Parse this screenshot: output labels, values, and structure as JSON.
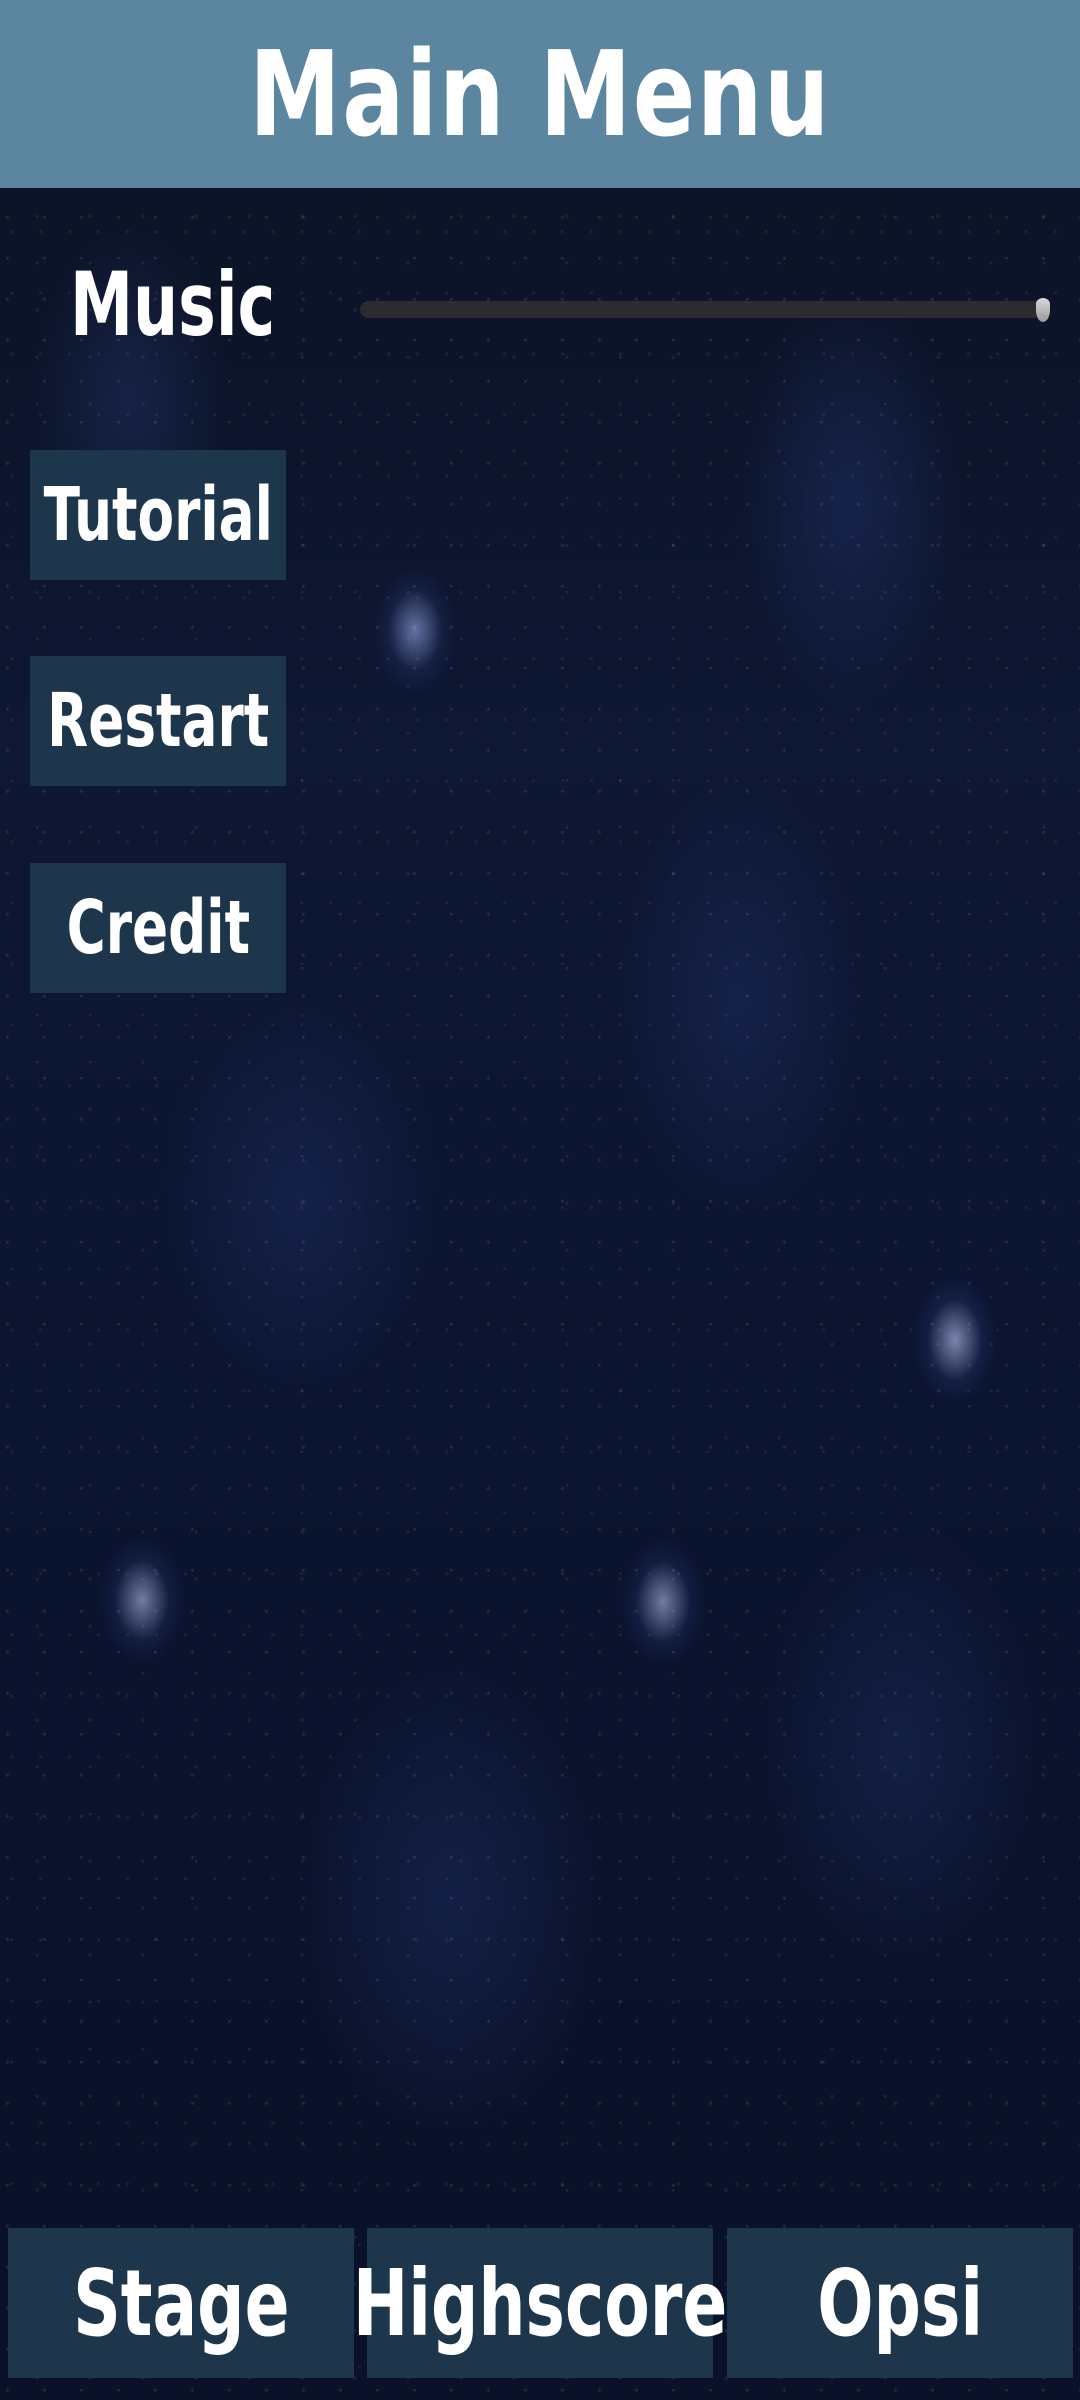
{
  "header": {
    "title": "Main Menu"
  },
  "settings": {
    "music_label": "Music",
    "music_volume": 1.0
  },
  "side_menu": {
    "tutorial": "Tutorial",
    "restart": "Restart",
    "credit": "Credit"
  },
  "bottom_nav": {
    "stage": "Stage",
    "highscore": "Highscore",
    "opsi": "Opsi"
  },
  "colors": {
    "header_bg": "#5c869f",
    "button_bg": "#1e364b",
    "background": "#0e1733"
  }
}
